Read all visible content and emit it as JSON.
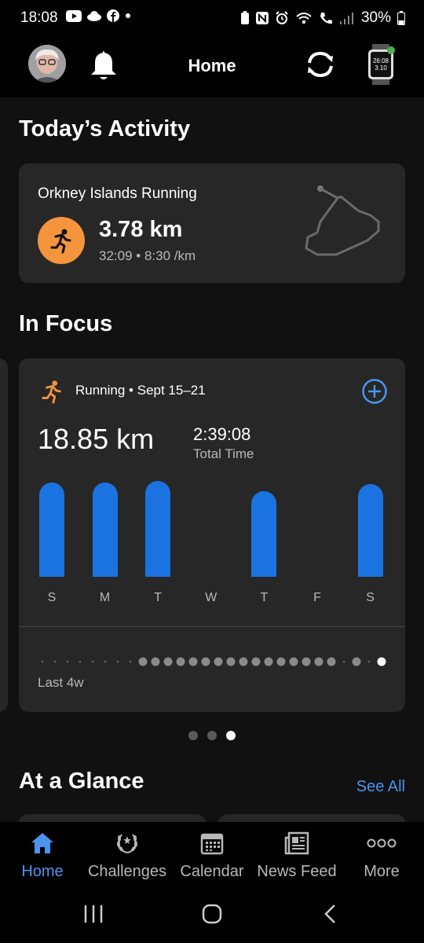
{
  "status_bar": {
    "time": "18:08",
    "battery": "30%"
  },
  "header": {
    "title": "Home"
  },
  "todays_activity": {
    "section_title": "Today’s Activity",
    "name": "Orkney Islands Running",
    "distance": "3.78 km",
    "details": "32:09 • 8:30 /km",
    "accent_color": "#f4943c"
  },
  "in_focus": {
    "section_title": "In Focus",
    "title": "Running • Sept 15–21",
    "distance": "18.85 km",
    "total_time": "2:39:08",
    "total_time_label": "Total Time",
    "days": [
      {
        "label": "S",
        "value": 0.97
      },
      {
        "label": "M",
        "value": 0.97
      },
      {
        "label": "T",
        "value": 0.98
      },
      {
        "label": "W",
        "value": 0
      },
      {
        "label": "T",
        "value": 0.88
      },
      {
        "label": "F",
        "value": 0
      },
      {
        "label": "S",
        "value": 0.95
      }
    ],
    "bar_color": "#1a73e0",
    "history_label": "Last 4w",
    "pager": {
      "count": 3,
      "active": 2
    }
  },
  "at_a_glance": {
    "section_title": "At a Glance",
    "see_all": "See All"
  },
  "nav": [
    {
      "label": "Home",
      "icon": "home-icon",
      "active": true
    },
    {
      "label": "Challenges",
      "icon": "laurel-icon",
      "active": false
    },
    {
      "label": "Calendar",
      "icon": "calendar-icon",
      "active": false
    },
    {
      "label": "News Feed",
      "icon": "newspaper-icon",
      "active": false
    },
    {
      "label": "More",
      "icon": "more-dots-icon",
      "active": false
    }
  ],
  "accent_color": "#4c94ef"
}
